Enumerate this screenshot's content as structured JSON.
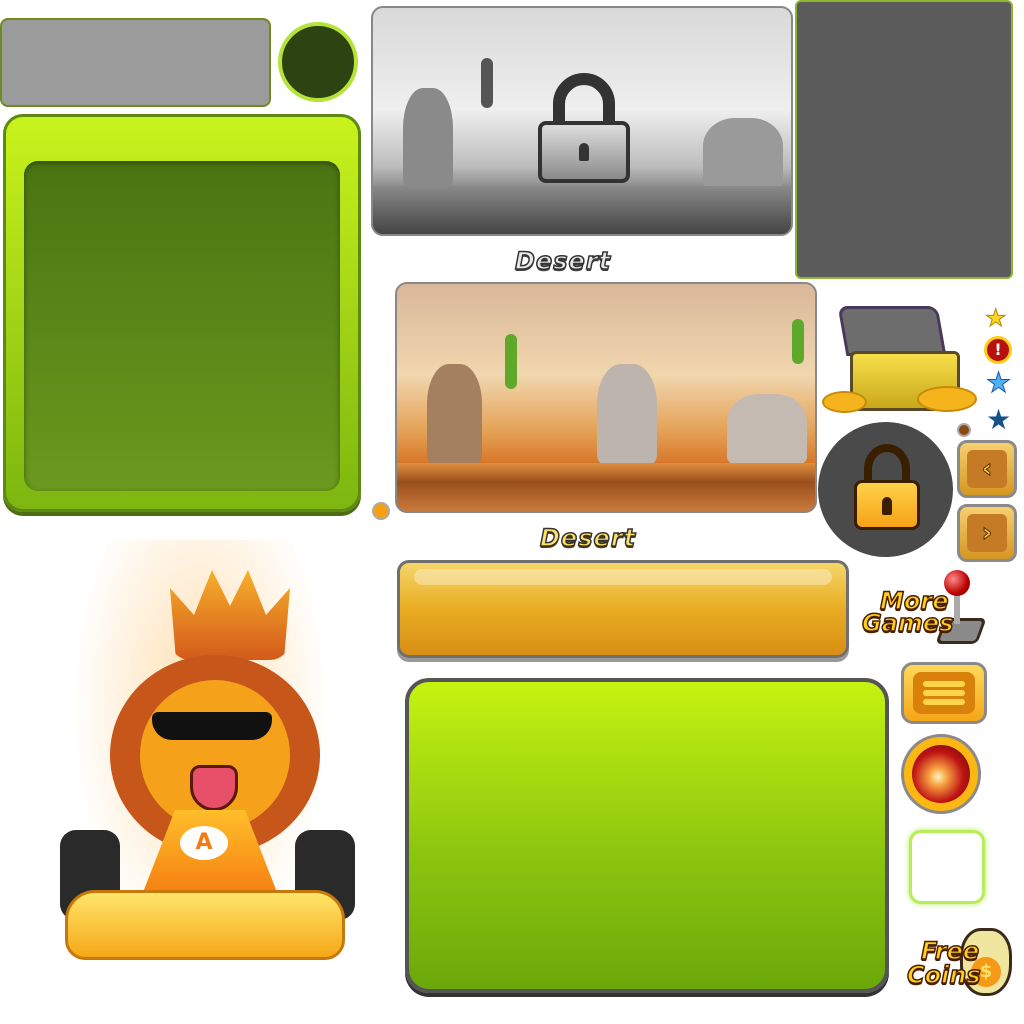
{
  "level_select": {
    "level_name_locked": "Desert",
    "level_name_unlocked": "Desert"
  },
  "buttons": {
    "more_games": [
      "More",
      "Games"
    ],
    "free_coins": [
      "Free",
      "Coins"
    ],
    "prev_arrow": "‹",
    "next_arrow": "›",
    "coin_symbol": "$"
  },
  "mascot": {
    "kart_logo": "A"
  },
  "icons": {
    "star_gold": "★",
    "alert": "!",
    "star_light_blue": "★",
    "star_dark_blue": "★"
  },
  "colors": {
    "accent_green": "#a6e01a",
    "accent_gold": "#f5b31c",
    "dark_grey": "#4a4a4a"
  }
}
